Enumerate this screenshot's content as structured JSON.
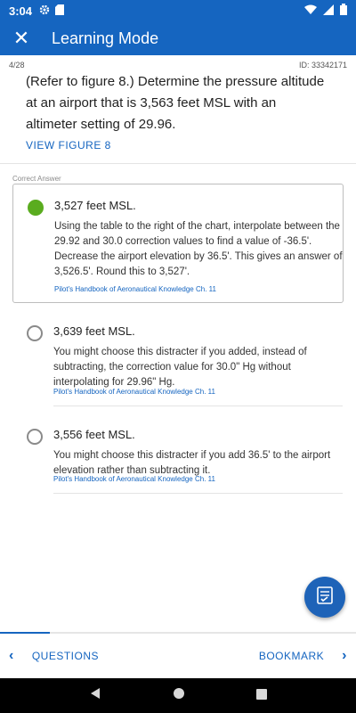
{
  "status_bar": {
    "time": "3:04",
    "icons": [
      "gear-icon",
      "sd-card-icon",
      "wifi-icon",
      "signal-icon",
      "battery-icon"
    ]
  },
  "app_bar": {
    "title": "Learning Mode",
    "close_icon": "close-icon"
  },
  "question_meta": {
    "position": "4/28",
    "id": "ID: 33342171"
  },
  "question": {
    "text": "(Refer to figure 8.) Determine the pressure altitude at an airport that is 3,563 feet MSL with an altimeter setting of 29.96.",
    "view_figure": "VIEW FIGURE 8"
  },
  "correct_label": "Correct Answer",
  "answers": [
    {
      "title": "3,527 feet MSL.",
      "explanation": "Using the table to the right of the chart, interpolate between the 29.92 and 30.0 correction values to find a value of -36.5'.  Decrease the airport elevation by 36.5'.  This gives an answer of 3,526.5'.  Round this to 3,527'.",
      "reference": "Pilot's Handbook of Aeronautical Knowledge Ch. 11",
      "selected": true
    },
    {
      "title": "3,639 feet MSL.",
      "explanation": "You might choose this distracter if you added, instead of subtracting, the correction value for 30.0\" Hg without interpolating for 29.96\" Hg.",
      "reference": "Pilot's Handbook of Aeronautical Knowledge Ch. 11",
      "selected": false
    },
    {
      "title": "3,556 feet MSL.",
      "explanation": "You might choose this distracter if you add 36.5' to the airport elevation rather than subtracting it.",
      "reference": "Pilot's Handbook of Aeronautical Knowledge Ch. 11",
      "selected": false
    }
  ],
  "progress": {
    "fraction": 0.14
  },
  "bottom_nav": {
    "questions": "QUESTIONS",
    "bookmark": "BOOKMARK"
  },
  "colors": {
    "primary": "#1565c0",
    "correct": "#5aac1f"
  }
}
